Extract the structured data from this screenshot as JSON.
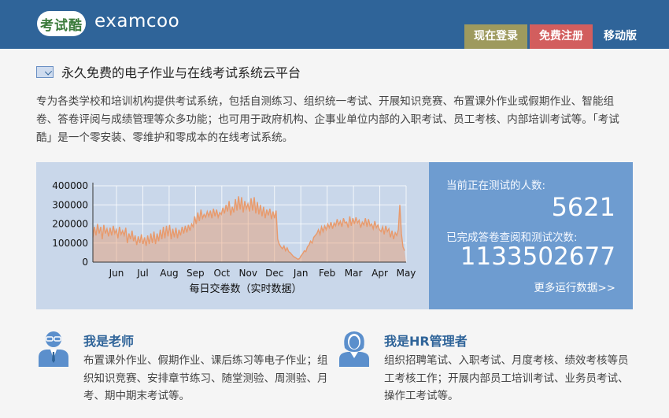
{
  "header": {
    "logo_badge": "考试酷",
    "logo_text": "examcoo",
    "nav": {
      "login": "现在登录",
      "register": "免费注册",
      "mobile": "移动版"
    }
  },
  "main": {
    "title": "永久免费的电子作业与在线考试系统云平台",
    "intro": "专为各类学校和培训机构提供考试系统，包括自测练习、组织统一考试、开展知识竞赛、布置课外作业或假期作业、智能组卷、答卷评阅与成绩管理等众多功能；也可用于政府机构、企事业单位内部的入职考试、员工考核、内部培训考试等。「考试酷」是一个零安装、零维护和零成本的在线考试系统。"
  },
  "stats": {
    "current_label": "当前正在测试的人数:",
    "current_value": "5621",
    "completed_label": "已完成答卷查阅和测试次数:",
    "completed_value": "1133502677",
    "more_link": "更多运行数据>>"
  },
  "chart_data": {
    "type": "area",
    "title": "",
    "xlabel": "每日交卷数（实时数据）",
    "ylabel": "",
    "categories": [
      "Jun",
      "Jul",
      "Aug",
      "Sep",
      "Oct",
      "Nov",
      "Dec",
      "Jan",
      "Feb",
      "Mar",
      "Apr",
      "May"
    ],
    "yticks": [
      "400000",
      "300000",
      "200000",
      "100000",
      "0"
    ],
    "ylim": [
      0,
      400000
    ],
    "grid": true,
    "x": [
      0,
      1,
      2,
      3,
      4,
      5,
      6,
      7,
      8,
      9,
      10,
      11,
      12,
      13,
      14,
      15,
      16,
      17,
      18,
      19,
      20,
      21,
      22,
      23,
      24,
      25,
      26,
      27,
      28,
      29,
      30,
      31,
      32,
      33,
      34,
      35,
      36,
      37,
      38,
      39,
      40,
      41,
      42,
      43,
      44,
      45,
      46,
      47,
      48,
      49,
      50,
      51,
      52,
      53,
      54,
      55,
      56,
      57,
      58,
      59,
      60,
      61,
      62,
      63,
      64,
      65,
      66,
      67,
      68,
      69,
      70,
      71,
      72,
      73,
      74,
      75,
      76,
      77,
      78,
      79,
      80,
      81,
      82,
      83,
      84,
      85,
      86,
      87,
      88,
      89,
      90,
      91,
      92,
      93,
      94,
      95,
      96,
      97,
      98,
      99,
      100,
      101,
      102,
      103,
      104,
      105,
      106,
      107,
      108,
      109,
      110,
      111,
      112,
      113,
      114,
      115,
      116,
      117,
      118,
      119,
      120,
      121,
      122,
      123,
      124,
      125,
      126,
      127,
      128,
      129,
      130,
      131,
      132,
      133,
      134,
      135,
      136,
      137,
      138,
      139,
      140,
      141,
      142,
      143,
      144,
      145,
      146,
      147,
      148,
      149,
      150,
      151,
      152,
      153,
      154,
      155,
      156,
      157,
      158,
      159,
      160,
      161,
      162,
      163,
      164,
      165,
      166,
      167,
      168,
      169,
      170,
      171,
      172,
      173,
      174,
      175,
      176,
      177,
      178,
      179,
      180,
      181,
      182,
      183,
      184,
      185,
      186,
      187,
      188,
      189,
      190,
      191,
      192,
      193,
      194,
      195,
      196,
      197,
      198,
      199,
      200
    ],
    "series": [
      {
        "values": [
          130000,
          185000,
          140000,
          200000,
          150000,
          185000,
          120000,
          195000,
          150000,
          175000,
          135000,
          180000,
          140000,
          190000,
          150000,
          170000,
          125000,
          185000,
          145000,
          165000,
          140000,
          180000,
          100000,
          150000,
          120000,
          165000,
          110000,
          140000,
          90000,
          135000,
          100000,
          145000,
          95000,
          130000,
          85000,
          140000,
          95000,
          150000,
          100000,
          160000,
          95000,
          150000,
          110000,
          170000,
          120000,
          185000,
          125000,
          190000,
          135000,
          195000,
          120000,
          175000,
          130000,
          180000,
          125000,
          170000,
          140000,
          185000,
          150000,
          190000,
          155000,
          195000,
          165000,
          200000,
          185000,
          240000,
          200000,
          260000,
          215000,
          275000,
          230000,
          250000,
          235000,
          265000,
          240000,
          270000,
          230000,
          280000,
          240000,
          275000,
          235000,
          260000,
          250000,
          285000,
          255000,
          300000,
          265000,
          320000,
          245000,
          290000,
          260000,
          330000,
          270000,
          345000,
          275000,
          340000,
          260000,
          320000,
          280000,
          305000,
          265000,
          335000,
          270000,
          340000,
          255000,
          315000,
          250000,
          300000,
          240000,
          290000,
          230000,
          275000,
          245000,
          280000,
          225000,
          265000,
          230000,
          270000,
          120000,
          95000,
          80000,
          70000,
          85000,
          60000,
          75000,
          55000,
          50000,
          40000,
          30000,
          25000,
          20000,
          15000,
          20000,
          35000,
          45000,
          60000,
          55000,
          80000,
          90000,
          110000,
          100000,
          130000,
          140000,
          150000,
          170000,
          145000,
          185000,
          160000,
          190000,
          170000,
          200000,
          180000,
          210000,
          175000,
          205000,
          190000,
          225000,
          195000,
          215000,
          185000,
          230000,
          205000,
          210000,
          180000,
          240000,
          190000,
          230000,
          200000,
          235000,
          205000,
          220000,
          180000,
          210000,
          195000,
          230000,
          185000,
          225000,
          190000,
          200000,
          175000,
          215000,
          180000,
          195000,
          170000,
          160000,
          185000,
          145000,
          190000,
          160000,
          175000,
          130000,
          165000,
          120000,
          155000,
          140000,
          170000,
          300000,
          150000,
          80000,
          60000
        ],
        "color": "#e89a6c"
      }
    ]
  },
  "roles": [
    {
      "title": "我是老师",
      "desc": "布置课外作业、假期作业、课后练习等电子作业；组织知识竞赛、安排章节练习、随堂测验、周测验、月考、期中期末考试等。"
    },
    {
      "title": "我是HR管理者",
      "desc": "组织招聘笔试、入职考试、月度考核、绩效考核等员工考核工作；开展内部员工培训考试、业务员考试、操作工考试等。"
    }
  ],
  "colors": {
    "brand": "#2f6499",
    "login": "#9e9a5e",
    "register": "#d25e5e",
    "panel": "#6e9cd0",
    "chart_fill": "#e89a6c"
  }
}
